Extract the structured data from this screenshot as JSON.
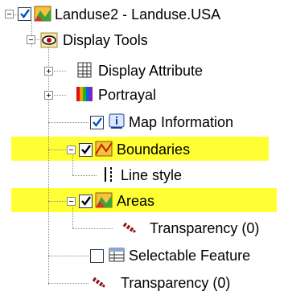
{
  "tree": {
    "nodes": [
      {
        "label": "Landuse2 - Landuse.USA",
        "checked": true,
        "expanded": true,
        "icon": "layer-landuse-icon"
      },
      {
        "label": "Display Tools",
        "expanded": true,
        "icon": "eye-icon"
      },
      {
        "label": "Display Attribute",
        "expanded": false,
        "icon": "table-icon"
      },
      {
        "label": "Portrayal",
        "expanded": false,
        "icon": "color-bars-icon"
      },
      {
        "label": "Map Information",
        "checked": true,
        "icon": "info-icon"
      },
      {
        "label": "Boundaries",
        "checked": true,
        "expanded": true,
        "highlighted": true,
        "icon": "boundary-layer-icon"
      },
      {
        "label": "Line style",
        "icon": "line-style-icon"
      },
      {
        "label": "Areas",
        "checked": true,
        "expanded": true,
        "highlighted": true,
        "icon": "area-layer-icon"
      },
      {
        "label": "Transparency (0)",
        "icon": "transparency-icon"
      },
      {
        "label": "Selectable Feature",
        "checked": false,
        "icon": "select-table-icon"
      },
      {
        "label": "Transparency (0)",
        "icon": "transparency-icon"
      }
    ]
  },
  "colors": {
    "highlight": "#ffff33"
  }
}
